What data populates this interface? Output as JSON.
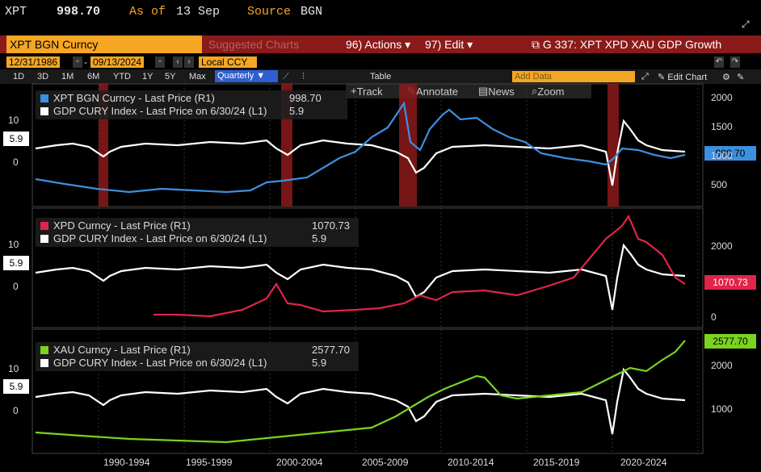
{
  "header": {
    "ticker": "XPT",
    "price": "998.70",
    "asof_label": "As of",
    "asof_date": "13 Sep",
    "source_label": "Source",
    "source": "BGN"
  },
  "redbar": {
    "security": "XPT BGN Curncy",
    "suggested": "Suggested Charts",
    "actions": "Actions",
    "edit": "Edit",
    "title": "G 337: XPT XPD XAU GDP Growth",
    "actions_num": "96)",
    "edit_num": "97)"
  },
  "dates": {
    "start": "12/31/1986",
    "end": "09/13/2024",
    "currency": "Local CCY"
  },
  "ranges": [
    "1D",
    "3D",
    "1M",
    "6M",
    "YTD",
    "1Y",
    "5Y",
    "Max"
  ],
  "frequency": "Quarterly",
  "table_label": "Table",
  "add_data": "Add Data",
  "edit_chart": "Edit Chart",
  "tools": {
    "track": "Track",
    "annotate": "Annotate",
    "news": "News",
    "zoom": "Zoom"
  },
  "panels": [
    {
      "legend1": "XPT BGN Curncy - Last Price (R1)",
      "value1": "998.70",
      "legend2": "GDP CURY Index - Last Price on 6/30/24 (L1)",
      "value2": "5.9",
      "left_tag": "5.9",
      "right_tag": "998.70",
      "color": "#3d8fe0",
      "right_ticks": [
        "2000",
        "1500",
        "1000",
        "500"
      ],
      "left_ticks": [
        "10",
        "0"
      ]
    },
    {
      "legend1": "XPD Curncy - Last Price (R1)",
      "value1": "1070.73",
      "legend2": "GDP CURY Index - Last Price on 6/30/24 (L1)",
      "value2": "5.9",
      "left_tag": "5.9",
      "right_tag": "1070.73",
      "color": "#e0244a",
      "right_ticks": [
        "2000",
        "0"
      ],
      "left_ticks": [
        "10",
        "0"
      ]
    },
    {
      "legend1": "XAU Curncy - Last Price (R1)",
      "value1": "2577.70",
      "legend2": "GDP CURY Index - Last Price on 6/30/24 (L1)",
      "value2": "5.9",
      "left_tag": "5.9",
      "right_tag": "2577.70",
      "color": "#7ad31e",
      "right_ticks": [
        "2000",
        "1000"
      ],
      "left_ticks": [
        "10",
        "0"
      ]
    }
  ],
  "x_labels": [
    "1990-1994",
    "1995-1999",
    "2000-2004",
    "2005-2009",
    "2010-2014",
    "2015-2019",
    "2020-2024"
  ],
  "colors": {
    "gdp": "#ffffff",
    "recession": "#8b1a1a",
    "accent": "#f5a623"
  }
}
